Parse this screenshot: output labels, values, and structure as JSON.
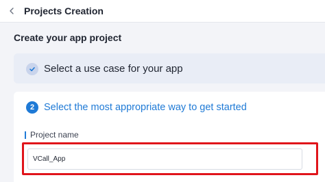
{
  "header": {
    "back_icon": "chevron-left-icon",
    "title": "Projects Creation"
  },
  "main": {
    "section_title": "Create your app project",
    "steps": [
      {
        "status": "done",
        "icon": "check-icon",
        "label": "Select a use case for your app"
      },
      {
        "status": "active",
        "number": "2",
        "label": "Select the most appropriate way to get started"
      }
    ],
    "project_name": {
      "label": "Project name",
      "value": "VCall_App"
    }
  },
  "colors": {
    "accent": "#1f7ad6",
    "highlight": "#e0141a",
    "background": "#f3f4f8"
  }
}
